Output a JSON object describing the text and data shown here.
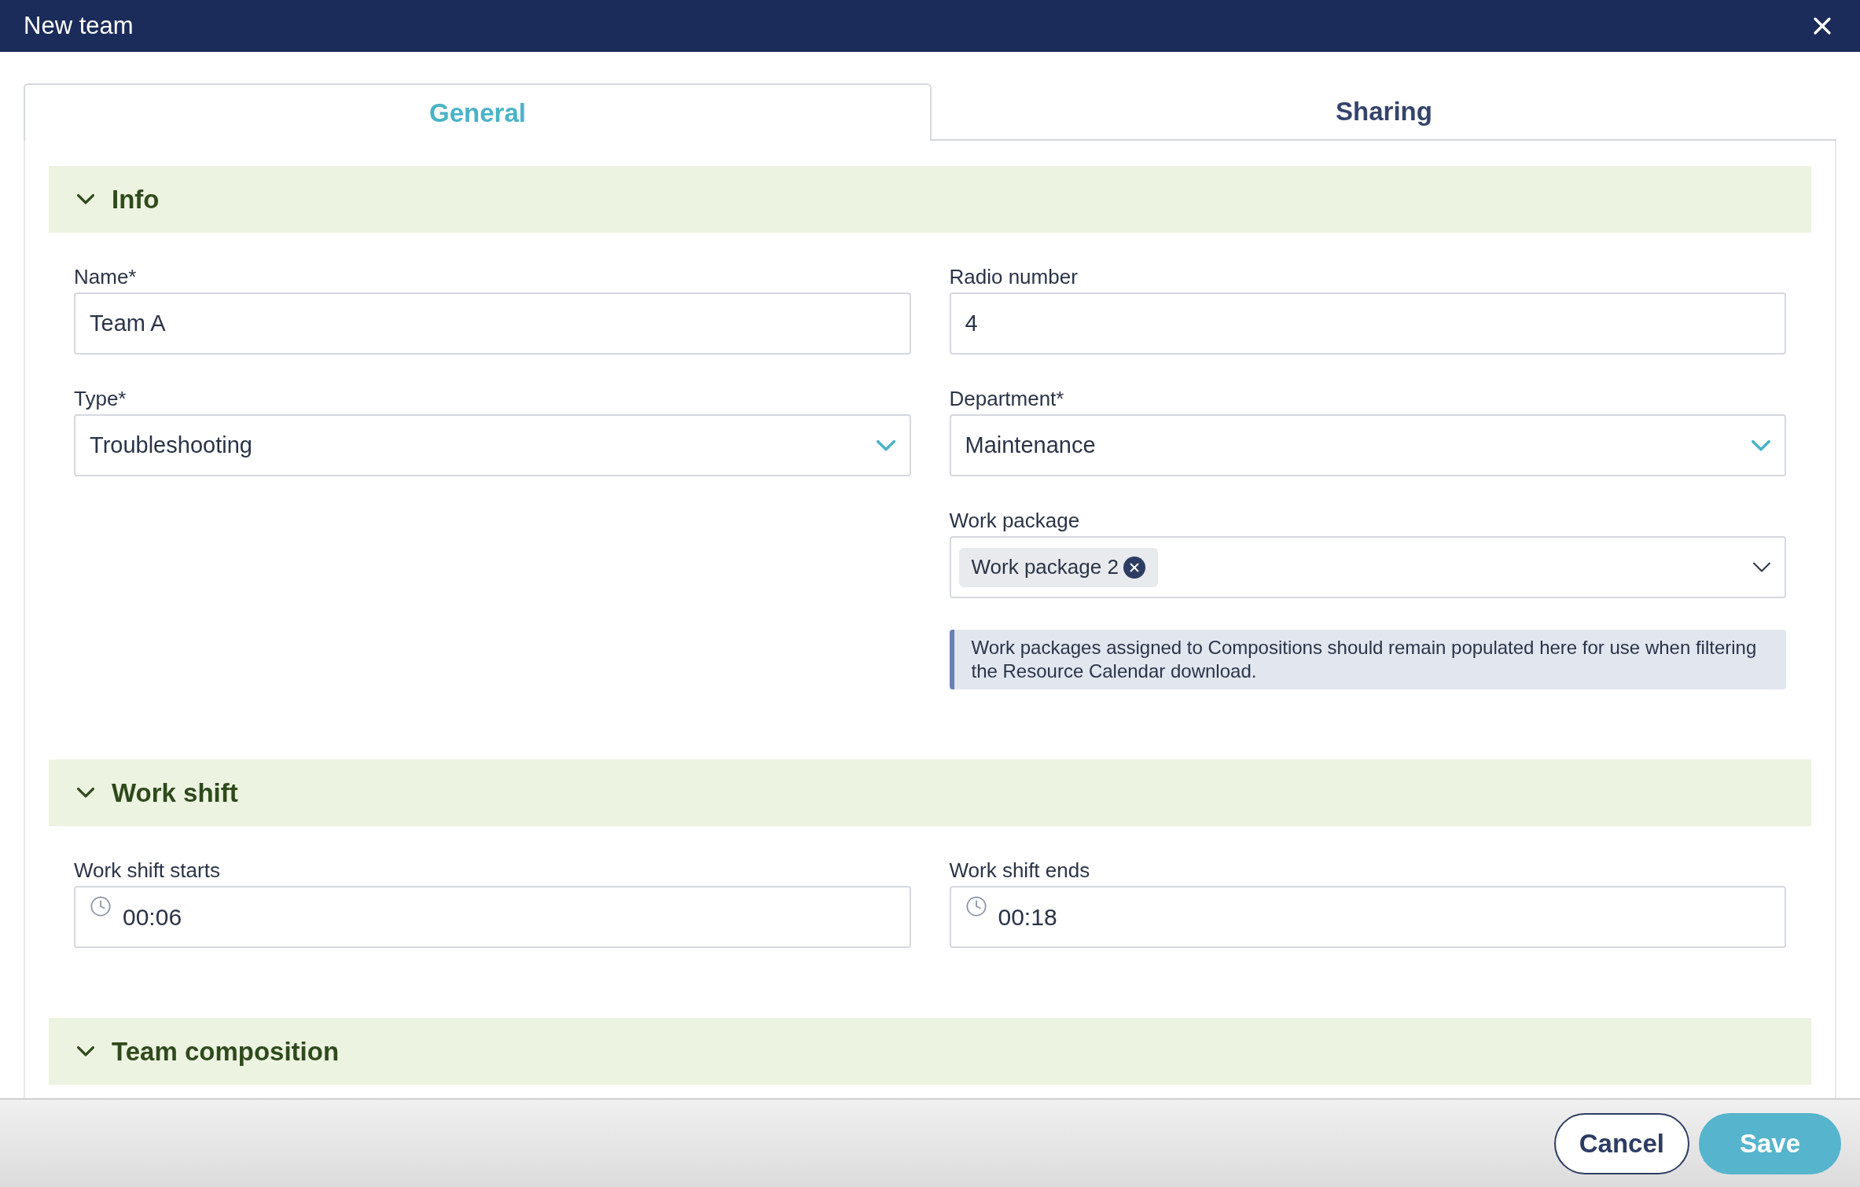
{
  "window": {
    "title": "New team"
  },
  "tabs": [
    {
      "label": "General",
      "selected": true
    },
    {
      "label": "Sharing",
      "selected": false
    }
  ],
  "sections": [
    {
      "title": "Info",
      "expanded": true,
      "columns": [
        [
          {
            "kind": "text",
            "label": "Name*",
            "value": "Team A"
          },
          {
            "kind": "select",
            "label": "Type*",
            "value": "Troubleshooting"
          }
        ],
        [
          {
            "kind": "text",
            "label": "Radio number",
            "value": "4"
          },
          {
            "kind": "select",
            "label": "Department*",
            "value": "Maintenance"
          },
          {
            "kind": "multiselect",
            "label": "Work package",
            "chips": [
              "Work package 2"
            ]
          },
          {
            "kind": "note",
            "text": "Work packages assigned to Compositions should remain populated here for use when filtering the Resource Calendar download."
          }
        ]
      ]
    },
    {
      "title": "Work shift",
      "expanded": true,
      "columns": [
        [
          {
            "kind": "time",
            "label": "Work shift starts",
            "value": "00:06"
          }
        ],
        [
          {
            "kind": "time",
            "label": "Work shift ends",
            "value": "00:18"
          }
        ]
      ]
    },
    {
      "title": "Team composition",
      "expanded": true
    }
  ],
  "buttons": [
    {
      "label": "Cancel",
      "kind": "secondary"
    },
    {
      "label": "Save",
      "kind": "primary"
    }
  ]
}
